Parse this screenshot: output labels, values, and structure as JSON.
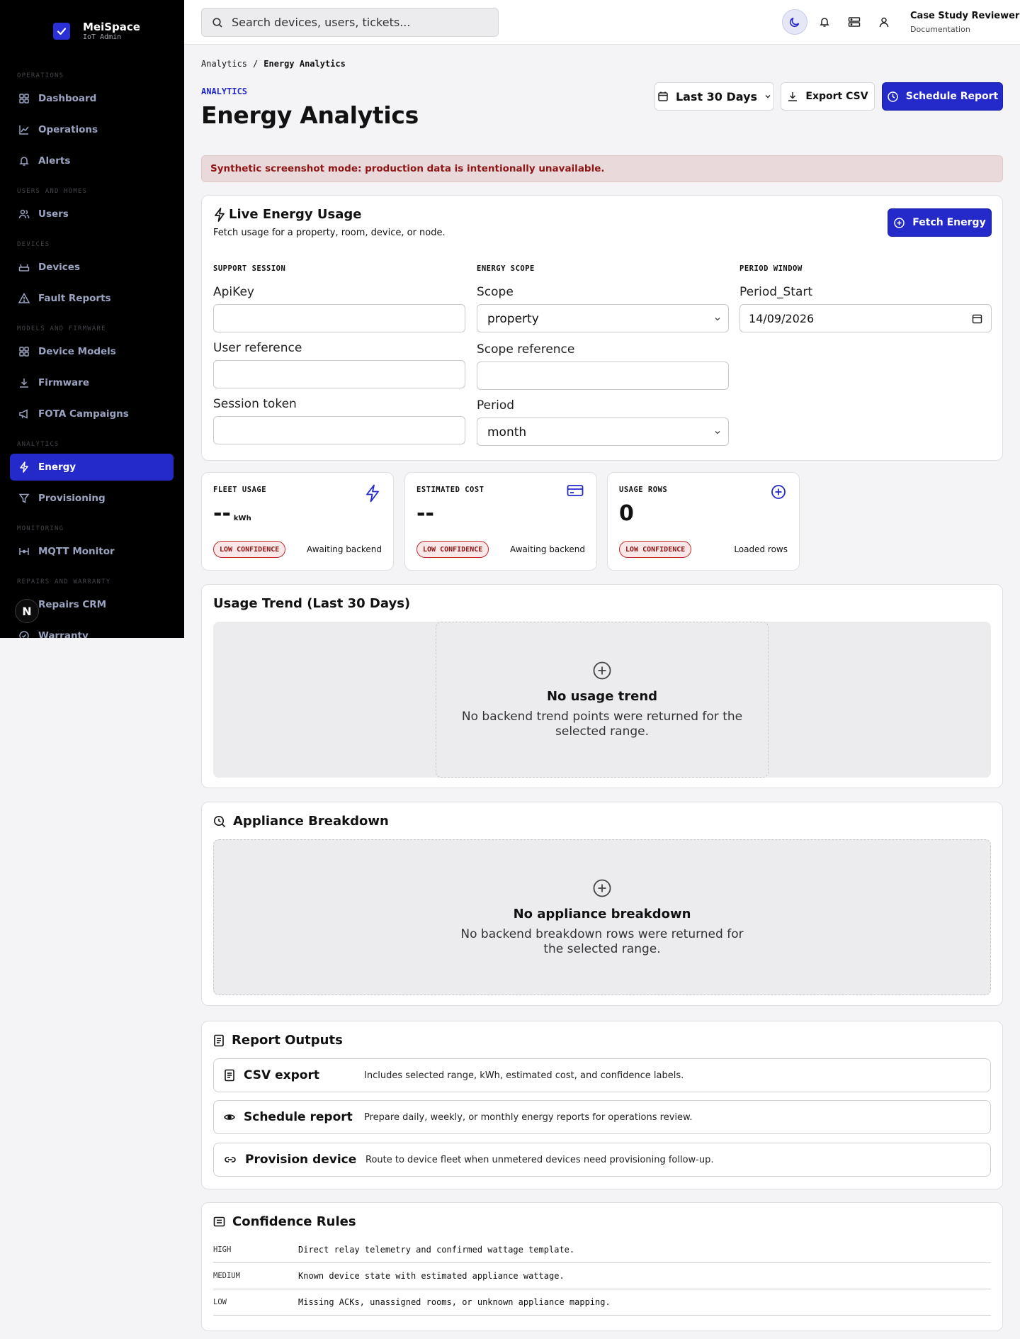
{
  "brand": {
    "name": "MeiSpace",
    "subtitle": "IoT Admin"
  },
  "sidebar": {
    "sections": [
      {
        "label": "OPERATIONS"
      },
      {
        "label": "USERS AND HOMES"
      },
      {
        "label": "DEVICES"
      },
      {
        "label": "MODELS AND FIRMWARE"
      },
      {
        "label": "ANALYTICS"
      },
      {
        "label": "MONITORING"
      },
      {
        "label": "REPAIRS AND WARRANTY"
      }
    ],
    "items": [
      {
        "label": "Dashboard",
        "icon": "grid-icon"
      },
      {
        "label": "Operations",
        "icon": "chart-line-icon"
      },
      {
        "label": "Alerts",
        "icon": "bell-icon"
      },
      {
        "label": "Users",
        "icon": "users-icon"
      },
      {
        "label": "Devices",
        "icon": "router-icon"
      },
      {
        "label": "Fault Reports",
        "icon": "warning-icon"
      },
      {
        "label": "Device Models",
        "icon": "grid-icon"
      },
      {
        "label": "Firmware",
        "icon": "download-icon"
      },
      {
        "label": "FOTA Campaigns",
        "icon": "megaphone-icon"
      },
      {
        "label": "Energy",
        "icon": "bolt-icon",
        "active": true
      },
      {
        "label": "Provisioning",
        "icon": "filter-icon"
      },
      {
        "label": "MQTT Monitor",
        "icon": "network-icon"
      },
      {
        "label": "Repairs CRM",
        "icon": "wrench-icon"
      },
      {
        "label": "Warranty",
        "icon": "check-circle-icon"
      }
    ],
    "badge": "N"
  },
  "topbar": {
    "search_placeholder": "Search devices, users, tickets...",
    "user_name": "Case Study Reviewer",
    "user_role": "Documentation"
  },
  "breadcrumb": {
    "parent": "Analytics",
    "separator": "/",
    "current": "Energy Analytics"
  },
  "header": {
    "eyebrow": "ANALYTICS",
    "title": "Energy Analytics",
    "range_label": "Last 30 Days",
    "export_label": "Export CSV",
    "schedule_label": "Schedule Report"
  },
  "banner": "Synthetic screenshot mode: production data is intentionally unavailable.",
  "live": {
    "title": "Live Energy Usage",
    "subtitle": "Fetch usage for a property, room, device, or node.",
    "fetch_label": "Fetch Energy",
    "support_heading": "SUPPORT SESSION",
    "scope_heading": "ENERGY SCOPE",
    "period_heading": "PERIOD WINDOW",
    "apikey_label": "ApiKey",
    "user_ref_label": "User reference",
    "session_token_label": "Session token",
    "scope_label": "Scope",
    "scope_value": "property",
    "scope_ref_label": "Scope reference",
    "period_label": "Period",
    "period_value": "month",
    "period_start_label": "Period_Start",
    "period_start_value": "14/09/2026"
  },
  "stats": [
    {
      "label": "FLEET USAGE",
      "value": "--",
      "unit": "kWh",
      "badge": "LOW CONFIDENCE",
      "note": "Awaiting backend",
      "icon": "bolt-icon"
    },
    {
      "label": "ESTIMATED COST",
      "value": "--",
      "unit": "",
      "badge": "LOW CONFIDENCE",
      "note": "Awaiting backend",
      "icon": "credit-card-icon"
    },
    {
      "label": "USAGE ROWS",
      "value": "0",
      "unit": "",
      "badge": "LOW CONFIDENCE",
      "note": "Loaded rows",
      "icon": "plus-circle-icon"
    }
  ],
  "trend": {
    "title": "Usage Trend (Last 30 Days)",
    "empty_title": "No usage trend",
    "empty_body": "No backend trend points were returned for the selected range."
  },
  "appliance": {
    "title": "Appliance Breakdown",
    "empty_title": "No appliance breakdown",
    "empty_body": "No backend breakdown rows were returned for the selected range."
  },
  "outputs": {
    "title": "Report Outputs",
    "rows": [
      {
        "title": "CSV export",
        "desc": "Includes selected range, kWh, estimated cost, and confidence labels.",
        "icon": "document-icon"
      },
      {
        "title": "Schedule report",
        "desc": "Prepare daily, weekly, or monthly energy reports for operations review.",
        "icon": "eye-icon"
      },
      {
        "title": "Provision device",
        "desc": "Route to device fleet when unmetered devices need provisioning follow-up.",
        "icon": "link-icon"
      }
    ]
  },
  "rules": {
    "title": "Confidence Rules",
    "rows": [
      {
        "level": "HIGH",
        "text": "Direct relay telemetry and confirmed wattage template."
      },
      {
        "level": "MEDIUM",
        "text": "Known device state with estimated appliance wattage."
      },
      {
        "level": "LOW",
        "text": "Missing ACKs, unassigned rooms, or unknown appliance mapping."
      }
    ]
  },
  "colors": {
    "accent": "#2429c9",
    "sidebar_bg": "#000000",
    "danger": "#8c1515",
    "banner_bg": "#ead9da"
  }
}
